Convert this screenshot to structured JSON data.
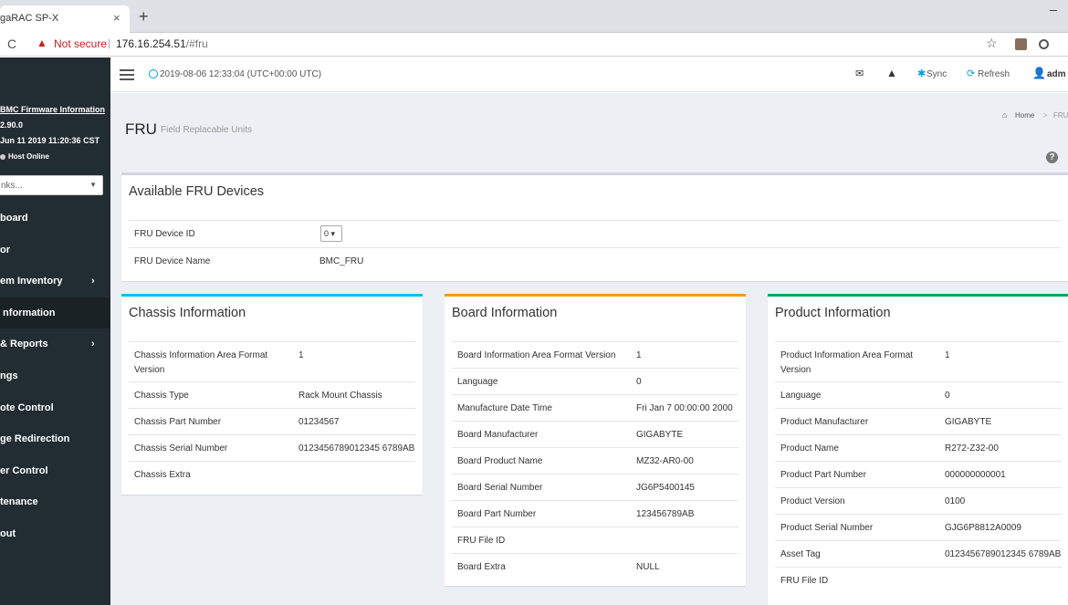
{
  "browser": {
    "tab_title": "gaRAC SP-X",
    "tab_close": "×",
    "new_tab": "+",
    "window_min": "–",
    "not_secure": "Not secure",
    "url_host": "176.16.254.51",
    "url_hash": "/#fru"
  },
  "sidebar": {
    "fw_title": "BMC Firmware Information",
    "fw_version": "2.90.0",
    "fw_date": "Jun 11 2019 11:20:36 CST",
    "host_status": "Host Online",
    "quick_links_placeholder": "nks...",
    "items": [
      {
        "label": "board",
        "chevron": ""
      },
      {
        "label": "or",
        "chevron": ""
      },
      {
        "label": "em Inventory",
        "chevron": "›"
      },
      {
        "label": "Information",
        "chevron": ""
      },
      {
        "label": "& Reports",
        "chevron": "›"
      },
      {
        "label": "ngs",
        "chevron": ""
      },
      {
        "label": "ote Control",
        "chevron": ""
      },
      {
        "label": "ge Redirection",
        "chevron": ""
      },
      {
        "label": "er Control",
        "chevron": ""
      },
      {
        "label": "tenance",
        "chevron": ""
      },
      {
        "label": "out",
        "chevron": ""
      }
    ]
  },
  "header": {
    "datetime": "2019-08-06 12:33:04 (UTC+00:00 UTC)",
    "sync": "Sync",
    "refresh": "Refresh",
    "user": "adm"
  },
  "page": {
    "title": "FRU",
    "subtitle": "Field Replacable Units",
    "breadcrumb_home": "Home",
    "breadcrumb_sep": ">",
    "breadcrumb_current": "FRU"
  },
  "available": {
    "title": "Available FRU Devices",
    "device_id_label": "FRU Device ID",
    "device_id_value": "0 ▾",
    "device_name_label": "FRU Device Name",
    "device_name_value": "BMC_FRU"
  },
  "chassis": {
    "title": "Chassis Information",
    "rows": [
      {
        "k": "Chassis Information Area Format Version",
        "v": "1"
      },
      {
        "k": "Chassis Type",
        "v": "Rack Mount Chassis"
      },
      {
        "k": "Chassis Part Number",
        "v": "01234567"
      },
      {
        "k": "Chassis Serial Number",
        "v": "0123456789012345 6789AB"
      },
      {
        "k": "Chassis Extra",
        "v": ""
      }
    ]
  },
  "board": {
    "title": "Board Information",
    "rows": [
      {
        "k": "Board Information Area Format Version",
        "v": "1"
      },
      {
        "k": "Language",
        "v": "0"
      },
      {
        "k": "Manufacture Date Time",
        "v": "Fri Jan 7 00:00:00 2000"
      },
      {
        "k": "Board Manufacturer",
        "v": "GIGABYTE"
      },
      {
        "k": "Board Product Name",
        "v": "MZ32-AR0-00"
      },
      {
        "k": "Board Serial Number",
        "v": "JG6P5400145"
      },
      {
        "k": "Board Part Number",
        "v": "123456789AB"
      },
      {
        "k": "FRU File ID",
        "v": ""
      },
      {
        "k": "Board Extra",
        "v": "NULL"
      }
    ]
  },
  "product": {
    "title": "Product Information",
    "rows": [
      {
        "k": "Product Information Area Format Version",
        "v": "1"
      },
      {
        "k": "Language",
        "v": "0"
      },
      {
        "k": "Product Manufacturer",
        "v": "GIGABYTE"
      },
      {
        "k": "Product Name",
        "v": "R272-Z32-00"
      },
      {
        "k": "Product Part Number",
        "v": "000000000001"
      },
      {
        "k": "Product Version",
        "v": "0100"
      },
      {
        "k": "Product Serial Number",
        "v": "GJG6P8812A0009"
      },
      {
        "k": "Asset Tag",
        "v": "0123456789012345 6789AB"
      },
      {
        "k": "FRU File ID",
        "v": ""
      }
    ]
  },
  "colors": {
    "sidebar_bg": "#222d32",
    "content_bg": "#ecf0f5",
    "chassis_accent": "#00c0ef",
    "board_accent": "#f39c12",
    "product_accent": "#00a65a",
    "link_accent": "#00a0e3"
  },
  "icons": [
    "reload-icon",
    "warning-icon",
    "star-icon",
    "hamburger-icon",
    "clock-icon",
    "mail-icon",
    "alert-icon",
    "sync-icon",
    "refresh-icon",
    "user-icon",
    "home-icon",
    "help-icon"
  ]
}
